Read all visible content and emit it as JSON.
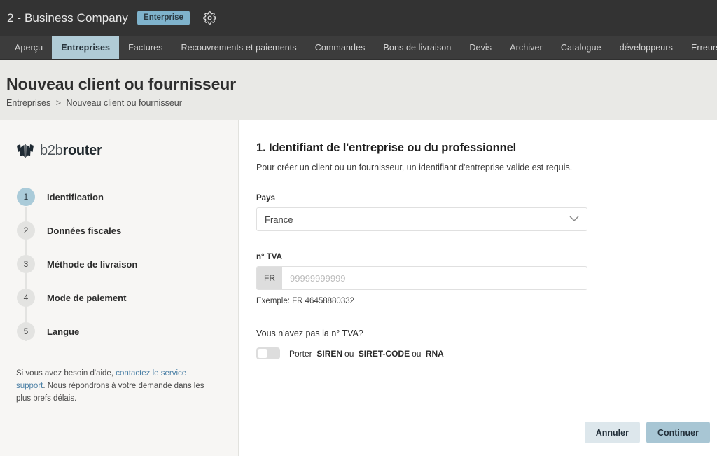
{
  "topbar": {
    "company": "2 - Business Company",
    "plan_badge": "Enterprise",
    "settings_icon": "gear-icon"
  },
  "nav": {
    "items": [
      {
        "label": "Aperçu",
        "active": false
      },
      {
        "label": "Entreprises",
        "active": true
      },
      {
        "label": "Factures",
        "active": false
      },
      {
        "label": "Recouvrements et paiements",
        "active": false
      },
      {
        "label": "Commandes",
        "active": false
      },
      {
        "label": "Bons de livraison",
        "active": false
      },
      {
        "label": "Devis",
        "active": false
      },
      {
        "label": "Archiver",
        "active": false
      },
      {
        "label": "Catalogue",
        "active": false
      },
      {
        "label": "développeurs",
        "active": false
      },
      {
        "label": "Erreurs",
        "active": false
      }
    ]
  },
  "page": {
    "title": "Nouveau client ou fournisseur",
    "breadcrumb_root": "Entreprises",
    "breadcrumb_sep": ">",
    "breadcrumb_current": "Nouveau client ou fournisseur"
  },
  "sidebar": {
    "logo_text_light": "b2b",
    "logo_text_bold": "router",
    "steps": [
      {
        "number": "1",
        "label": "Identification",
        "active": true
      },
      {
        "number": "2",
        "label": "Données fiscales",
        "active": false
      },
      {
        "number": "3",
        "label": "Méthode de livraison",
        "active": false
      },
      {
        "number": "4",
        "label": "Mode de paiement",
        "active": false
      },
      {
        "number": "5",
        "label": "Langue",
        "active": false
      }
    ],
    "help_before": "Si vous avez besoin d'aide, ",
    "help_link": "contactez le service support",
    "help_after": ". Nous répondrons à votre demande dans les plus brefs délais."
  },
  "form": {
    "title": "1. Identifiant de l'entreprise ou du professionnel",
    "subtitle": "Pour créer un client ou un fournisseur, un identifiant d'entreprise valide est requis.",
    "country_label": "Pays",
    "country_value": "France",
    "vat_label": "n° TVA",
    "vat_prefix": "FR",
    "vat_placeholder": "99999999999",
    "vat_value": "",
    "vat_hint": "Exemple: FR 46458880332",
    "toggle_question": "Vous n'avez pas la n° TVA?",
    "toggle_state": "off",
    "toggle_caption_lead": "Porter",
    "toggle_option_1": "SIREN",
    "toggle_or_1": "ou",
    "toggle_option_2": "SIRET-CODE",
    "toggle_or_2": "ou",
    "toggle_option_3": "RNA"
  },
  "actions": {
    "cancel": "Annuler",
    "continue": "Continuer"
  },
  "colors": {
    "topbar_bg": "#333333",
    "navbar_bg": "#3c3c3c",
    "accent_blue": "#7fb3cc",
    "active_tab": "#b0cbd6",
    "step_active": "#aacbd9",
    "link": "#4a7fa5",
    "btn_primary": "#a8c6d4",
    "btn_secondary": "#dde7ec"
  }
}
